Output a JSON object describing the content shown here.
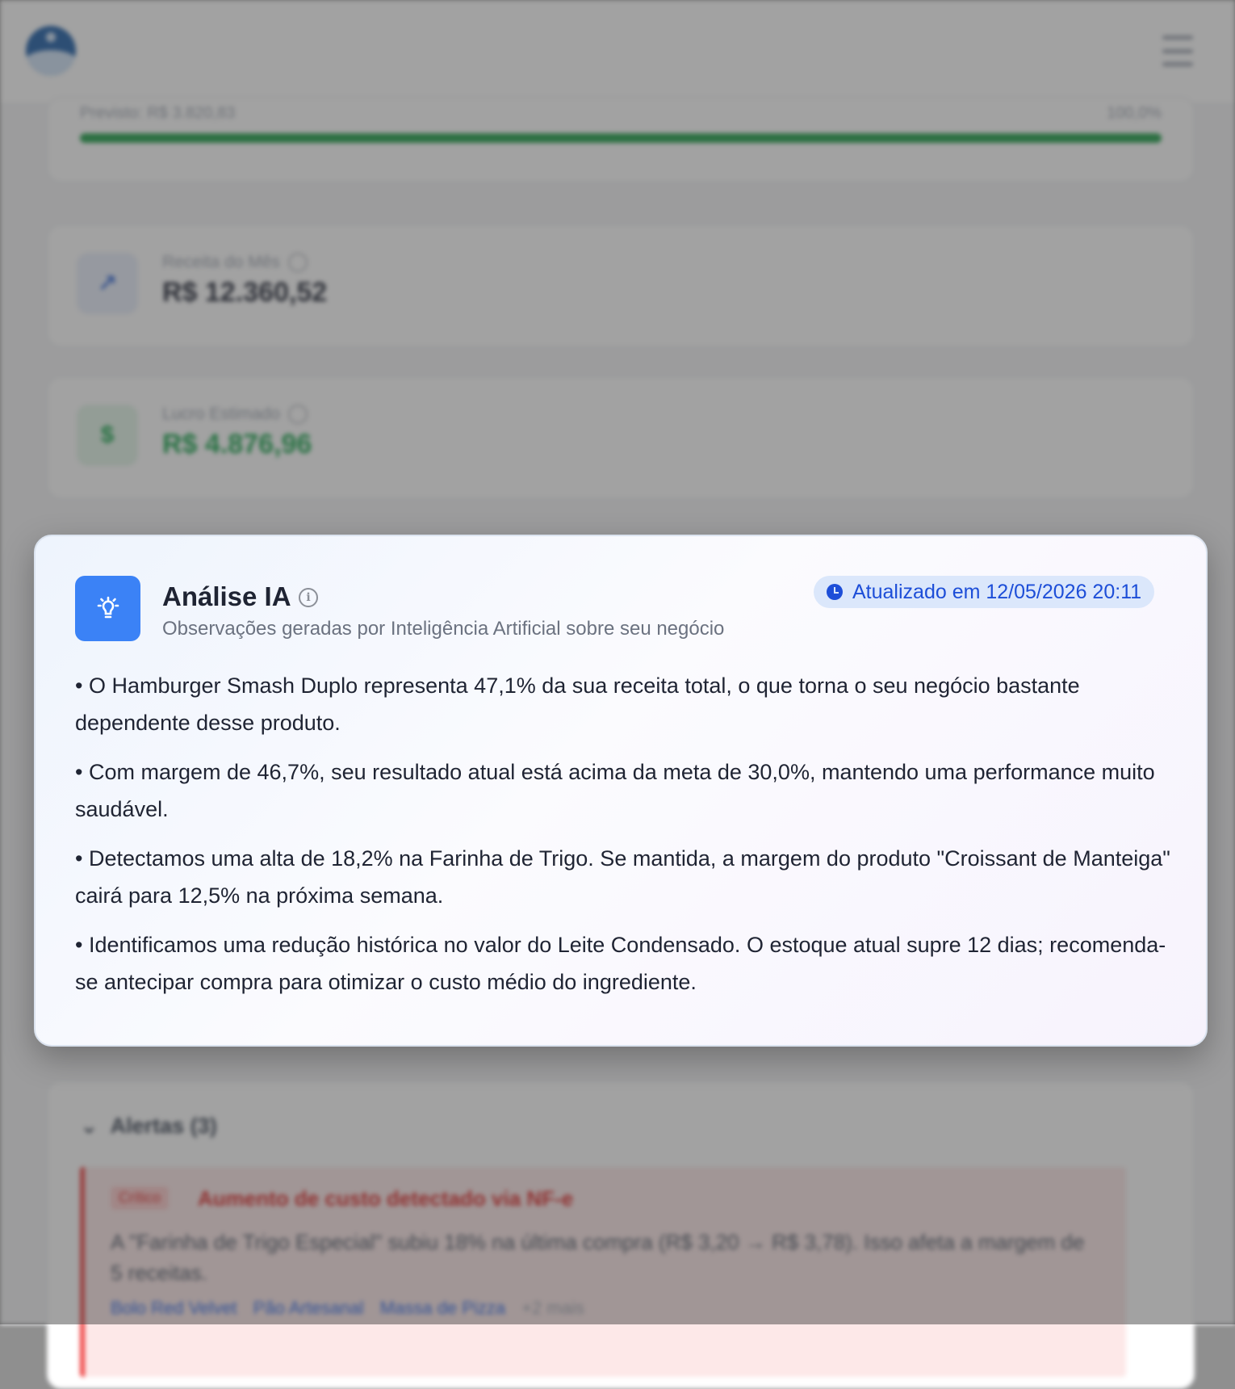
{
  "background": {
    "progress": {
      "label": "Previsto: R$ 3.820,83",
      "percent_label": "100,0%",
      "fraction": 1.0
    },
    "stats": [
      {
        "label": "Receita do Mês",
        "value": "R$ 12.360,52",
        "icon": "trending-up-icon",
        "color": "#1f2433"
      },
      {
        "label": "Lucro Estimado",
        "value": "R$ 4.876,96",
        "icon": "dollar-icon",
        "color": "#16a34a"
      }
    ],
    "alerts": {
      "header": "Alertas (3)",
      "item": {
        "badge": "Crítico",
        "title": "Aumento de custo detectado via NF-e",
        "text": "A \"Farinha de Trigo Especial\" subiu 18% na última compra (R$ 3,20 → R$ 3,78). Isso afeta a margem de 5 receitas.",
        "links": [
          "Bolo Red Velvet",
          "Pão Artesanal",
          "Massa de Pizza"
        ],
        "more": "+2 mais"
      }
    }
  },
  "modal": {
    "title": "Análise IA",
    "subtitle": "Observações geradas por Inteligência Artificial sobre seu negócio",
    "updated": "Atualizado em 12/05/2026 20:11",
    "insights": [
      "• O Hamburger Smash Duplo representa 47,1% da sua receita total, o que torna o seu negócio bastante dependente desse produto.",
      "• Com margem de 46,7%, seu resultado atual está acima da meta de 30,0%, mantendo uma performance muito saudável.",
      "• Detectamos uma alta de 18,2% na Farinha de Trigo. Se mantida, a margem do produto \"Croissant de Manteiga\" cairá para 12,5% na próxima semana.",
      "• Identificamos uma redução histórica no valor do Leite Condensado. O estoque atual supre 12 dias; recomenda-se antecipar compra para otimizar o custo médio do ingrediente."
    ]
  },
  "colors": {
    "accent": "#3b82f6",
    "success": "#22a04b",
    "danger": "#ef4444"
  }
}
